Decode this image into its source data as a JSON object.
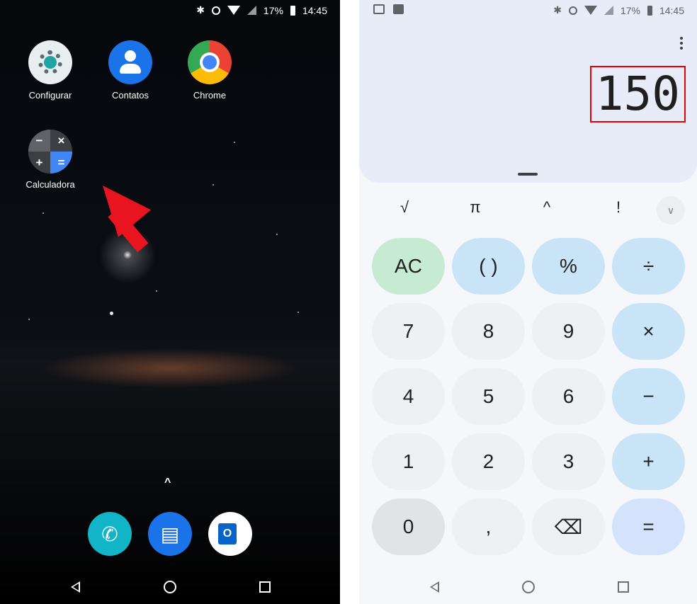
{
  "left": {
    "status": {
      "battery": "17%",
      "time": "14:45"
    },
    "apps": [
      {
        "label": "Configurar"
      },
      {
        "label": "Contatos"
      },
      {
        "label": "Chrome"
      },
      {
        "label": "Calculadora"
      }
    ],
    "calc_icon_symbols": [
      "−",
      "×",
      "+",
      "="
    ],
    "dock": [
      {
        "icon": "phone-icon"
      },
      {
        "icon": "messages-icon"
      },
      {
        "icon": "outlook-icon",
        "glyph": "O"
      }
    ]
  },
  "right": {
    "status": {
      "battery": "17%",
      "time": "14:45"
    },
    "result": "150",
    "advanced": [
      "√",
      "π",
      "^",
      "!"
    ],
    "keys": [
      [
        "AC",
        "( )",
        "%",
        "÷"
      ],
      [
        "7",
        "8",
        "9",
        "×"
      ],
      [
        "4",
        "5",
        "6",
        "−"
      ],
      [
        "1",
        "2",
        "3",
        "+"
      ],
      [
        "0",
        ",",
        "⌫",
        "="
      ]
    ]
  },
  "colors": {
    "highlight": "#e00000",
    "arrow": "#e8141f",
    "ac_key": "#c6ead2",
    "operator_key": "#c9e4f7",
    "number_key": "#eef0f4",
    "equals_key": "#d4e3fb"
  }
}
